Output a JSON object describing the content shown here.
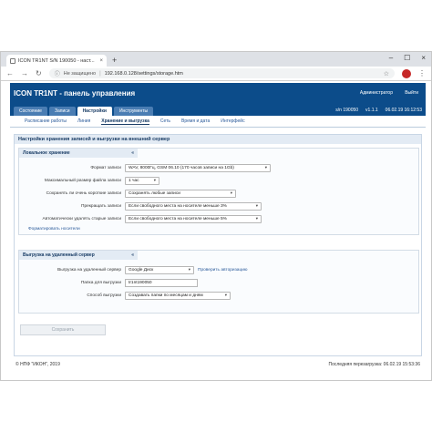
{
  "browser": {
    "tab_title": "ICON TR1NT S/N 190050 - наст...",
    "tab_close": "×",
    "new_tab": "+",
    "controls": {
      "minimize": "–",
      "maximize": "☐",
      "close": "×"
    },
    "back": "←",
    "forward": "→",
    "reload": "↻",
    "security_text": "Не защищено",
    "separator": "|",
    "url": "192.168.0.128/settings/storage.htm",
    "profile_initial": "",
    "star": "☆",
    "menu": "⋮"
  },
  "header": {
    "title": "ICON TR1NT - панель управления",
    "admin": "Администратор",
    "logout": "Выйти",
    "tabs": [
      {
        "label": "Состояние"
      },
      {
        "label": "Записи"
      },
      {
        "label": "Настройки"
      },
      {
        "label": "Инструменты"
      }
    ],
    "serial": "s/n 190050",
    "version": "v1.1.1",
    "datetime": "06.02.19 16:12:53"
  },
  "subtabs": [
    {
      "label": "Расписание работы"
    },
    {
      "label": "Линия"
    },
    {
      "label": "Хранение и выгрузка"
    },
    {
      "label": "Сеть"
    },
    {
      "label": "Время и дата"
    },
    {
      "label": "Интерфейс"
    }
  ],
  "panel": {
    "title": "Настройки хранения записей и выгрузки на внешний сервер",
    "local": {
      "title": "Локальное хранение",
      "collapse": "«",
      "rows": [
        {
          "label": "Формат записи",
          "value": "WAV, 8000Гц, GSM 06.10 (170 часов записи на 1Gb)"
        },
        {
          "label": "Максимальный размер файла записи",
          "value": "1 час"
        },
        {
          "label": "Сохранять ли очень короткие записи",
          "value": "Сохранять любые записи"
        },
        {
          "label": "Прекращать записи",
          "value": "Если свободного места на носителе меньше 3%"
        },
        {
          "label": "Автоматически удалять старые записи",
          "value": "Если свободного места на носителе меньше 5%"
        }
      ],
      "format_link": "Форматировать носители",
      "arrow": "▾"
    },
    "remote": {
      "title": "Выгрузка на удаленный сервер",
      "collapse": "«",
      "upload_label": "Выгрузка на удаленный сервер",
      "upload_value": "Google Диск",
      "check_auth": "Проверить авторизацию",
      "folder_label": "Папка для выгрузки",
      "folder_value": "tr1nt190050",
      "method_label": "Способ выгрузки",
      "method_value": "Создавать папки по месяцам и дням"
    },
    "save": "Сохранить"
  },
  "footer": {
    "left": "© НПФ \"ИКОН\", 2019",
    "right": "Последняя перезагрузка: 06.02.19 15:53:36"
  }
}
